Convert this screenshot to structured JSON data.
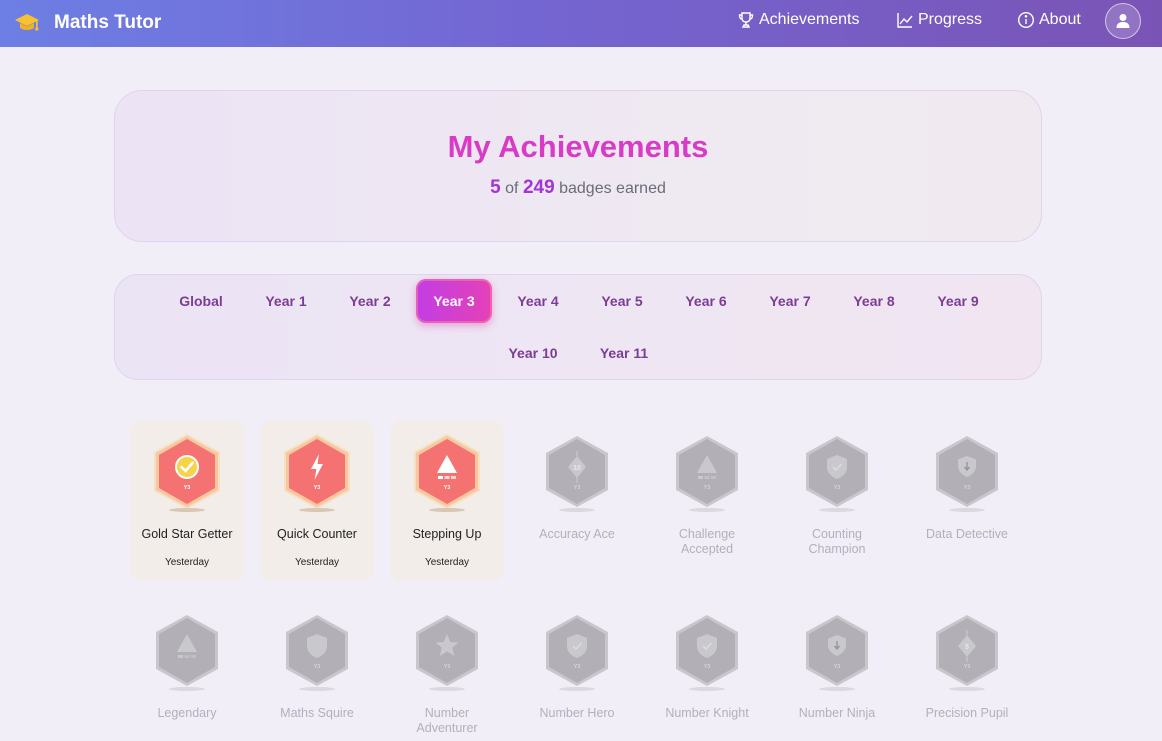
{
  "app": {
    "title": "Maths Tutor"
  },
  "nav": {
    "achievements": "Achievements",
    "progress": "Progress",
    "about": "About"
  },
  "hero": {
    "title": "My Achievements",
    "earned_count": "5",
    "of_text": "of",
    "total_count": "249",
    "suffix": "badges earned"
  },
  "tabs": [
    {
      "label": "Global"
    },
    {
      "label": "Year 1"
    },
    {
      "label": "Year 2"
    },
    {
      "label": "Year 3"
    },
    {
      "label": "Year 4"
    },
    {
      "label": "Year 5"
    },
    {
      "label": "Year 6"
    },
    {
      "label": "Year 7"
    },
    {
      "label": "Year 8"
    },
    {
      "label": "Year 9"
    },
    {
      "label": "Year 10"
    },
    {
      "label": "Year 11"
    }
  ],
  "active_tab": "Year 3",
  "badges": [
    {
      "name": "Gold Star Getter",
      "date": "Yesterday",
      "earned": true,
      "icon": "check-icon",
      "tag": "Y3"
    },
    {
      "name": "Quick Counter",
      "date": "Yesterday",
      "earned": true,
      "icon": "lightning-icon",
      "tag": "Y3"
    },
    {
      "name": "Stepping Up",
      "date": "Yesterday",
      "earned": true,
      "icon": "triangle-icon",
      "tag": "Y3"
    },
    {
      "name": "Accuracy Ace",
      "earned": false,
      "icon": "diamond-10-icon",
      "tag": "Y3",
      "icon_text": "10"
    },
    {
      "name": "Challenge Accepted",
      "earned": false,
      "icon": "triangle-icon",
      "tag": "Y3"
    },
    {
      "name": "Counting Champion",
      "earned": false,
      "icon": "shield-check-icon",
      "tag": "Y3"
    },
    {
      "name": "Data Detective",
      "earned": false,
      "icon": "shield-down-icon",
      "tag": "Y3"
    },
    {
      "name": "Legendary",
      "earned": false,
      "icon": "triangle-icon",
      "tag": ""
    },
    {
      "name": "Maths Squire",
      "earned": false,
      "icon": "shield-icon",
      "tag": "Y3"
    },
    {
      "name": "Number Adventurer",
      "earned": false,
      "icon": "star-icon",
      "tag": "Y3"
    },
    {
      "name": "Number Hero",
      "earned": false,
      "icon": "shield-check-icon",
      "tag": "Y3"
    },
    {
      "name": "Number Knight",
      "earned": false,
      "icon": "shield-check-icon",
      "tag": "Y3"
    },
    {
      "name": "Number Ninja",
      "earned": false,
      "icon": "shield-down-icon",
      "tag": "Y3"
    },
    {
      "name": "Precision Pupil",
      "earned": false,
      "icon": "diamond-5-icon",
      "tag": "Y3",
      "icon_text": "5"
    }
  ],
  "colors": {
    "accent_pink": "#d83cc6",
    "accent_purple": "#a434d6",
    "badge_earned": "#f47272",
    "badge_locked": "#b2b0b6"
  }
}
